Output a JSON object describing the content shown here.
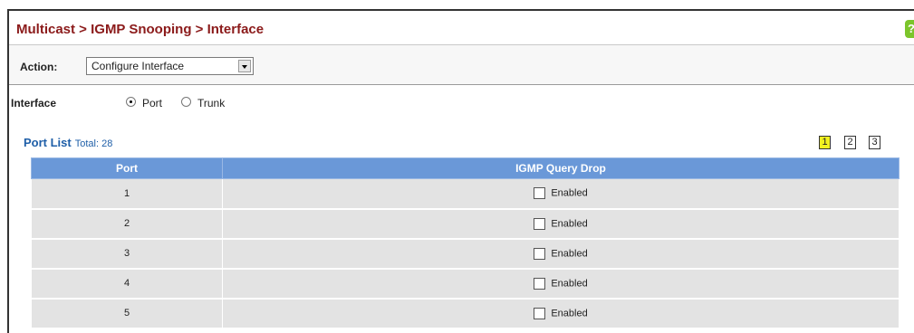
{
  "header": {
    "title": "Multicast > IGMP Snooping > Interface",
    "help_icon": "help-icon"
  },
  "action": {
    "label": "Action:",
    "selected": "Configure Interface"
  },
  "interface": {
    "label": "Interface",
    "options": [
      {
        "label": "Port",
        "selected": true
      },
      {
        "label": "Trunk",
        "selected": false
      }
    ]
  },
  "port_list": {
    "title": "Port List",
    "total": "Total: 28",
    "pages": [
      "1",
      "2",
      "3"
    ],
    "current_page": "1"
  },
  "table": {
    "columns": [
      "Port",
      "IGMP Query Drop"
    ],
    "rows": [
      {
        "port": "1",
        "label": "Enabled",
        "checked": false
      },
      {
        "port": "2",
        "label": "Enabled",
        "checked": false
      },
      {
        "port": "3",
        "label": "Enabled",
        "checked": false
      },
      {
        "port": "4",
        "label": "Enabled",
        "checked": false
      },
      {
        "port": "5",
        "label": "Enabled",
        "checked": false
      }
    ]
  },
  "colors": {
    "title": "#8b1a1a",
    "header_bg": "#6a98d8",
    "link": "#1f5fa8",
    "row_bg": "#e3e3e3",
    "current_page": "#f2f220"
  }
}
